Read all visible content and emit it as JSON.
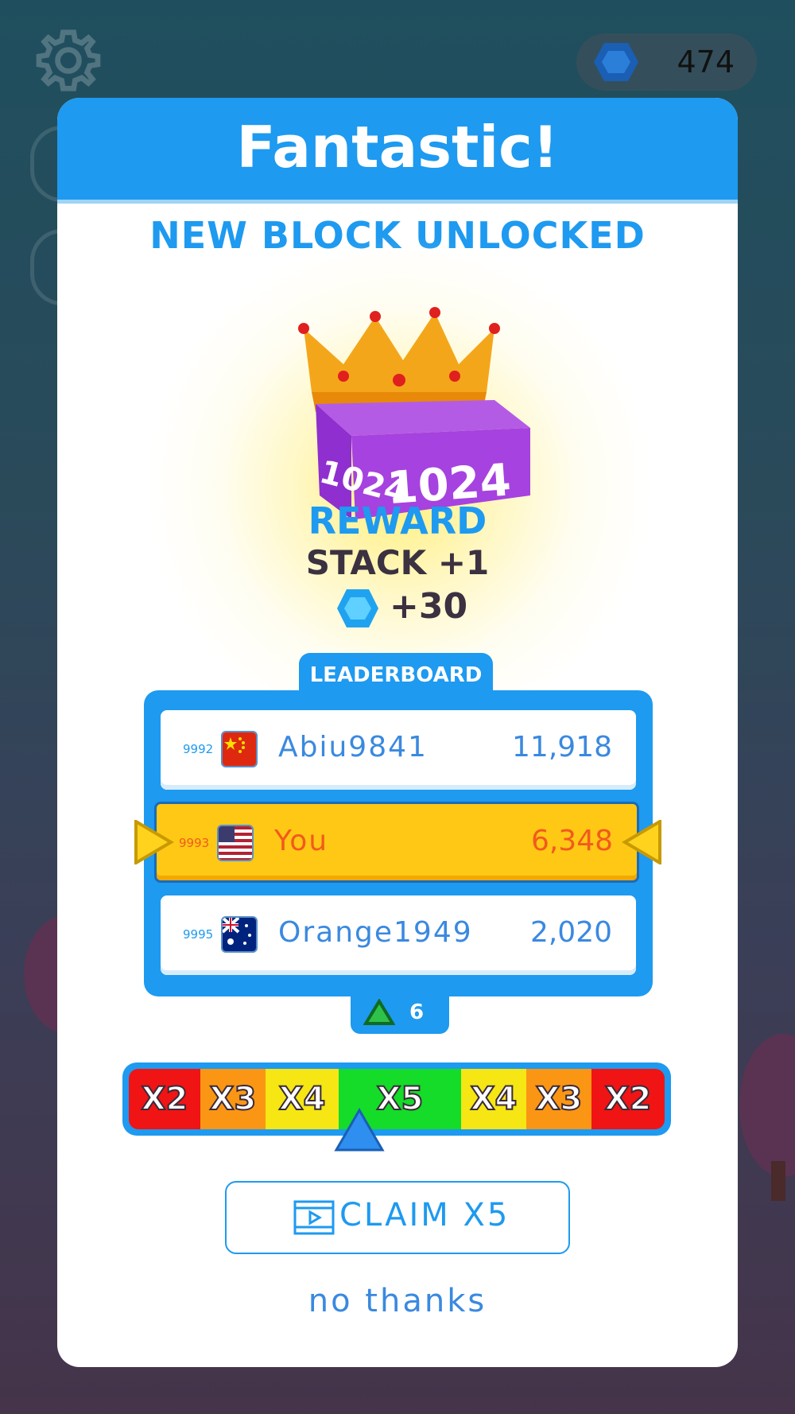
{
  "hud": {
    "settings_icon": "gear-icon",
    "gem_icon": "gem-icon",
    "gems": "474"
  },
  "popup": {
    "title": "Fantastic!",
    "subtitle": "NEW BLOCK UNLOCKED",
    "block": {
      "label_side": "1024",
      "label_front": "1024",
      "icon": "crown-icon"
    },
    "reward": {
      "title": "REWARD",
      "stack": "STACK +1",
      "gems": "+30"
    },
    "leaderboard": {
      "title": "LEADERBOARD",
      "rows": [
        {
          "rank": "9992",
          "flag": "china-flag-icon",
          "name": "Abiu9841",
          "score": "11,918",
          "highlight": false
        },
        {
          "rank": "9993",
          "flag": "usa-flag-icon",
          "name": "You",
          "score": "6,348",
          "highlight": true
        },
        {
          "rank": "9995",
          "flag": "australia-flag-icon",
          "name": "Orange1949",
          "score": "2,020",
          "highlight": false
        }
      ],
      "rank_change": "6"
    },
    "multipliers": [
      {
        "label": "X2",
        "color": "#f01414"
      },
      {
        "label": "X3",
        "color": "#fa9614"
      },
      {
        "label": "X4",
        "color": "#f5e614"
      },
      {
        "label": "X5",
        "color": "#14dc28"
      },
      {
        "label": "X4",
        "color": "#f5e614"
      },
      {
        "label": "X3",
        "color": "#fa9614"
      },
      {
        "label": "X2",
        "color": "#f01414"
      }
    ],
    "claim_label": "CLAIM X5",
    "no_thanks_label": "no thanks"
  },
  "colors": {
    "accent": "#1e9af0",
    "highlight": "#ffc814",
    "highlight_text": "#f25a1e"
  }
}
